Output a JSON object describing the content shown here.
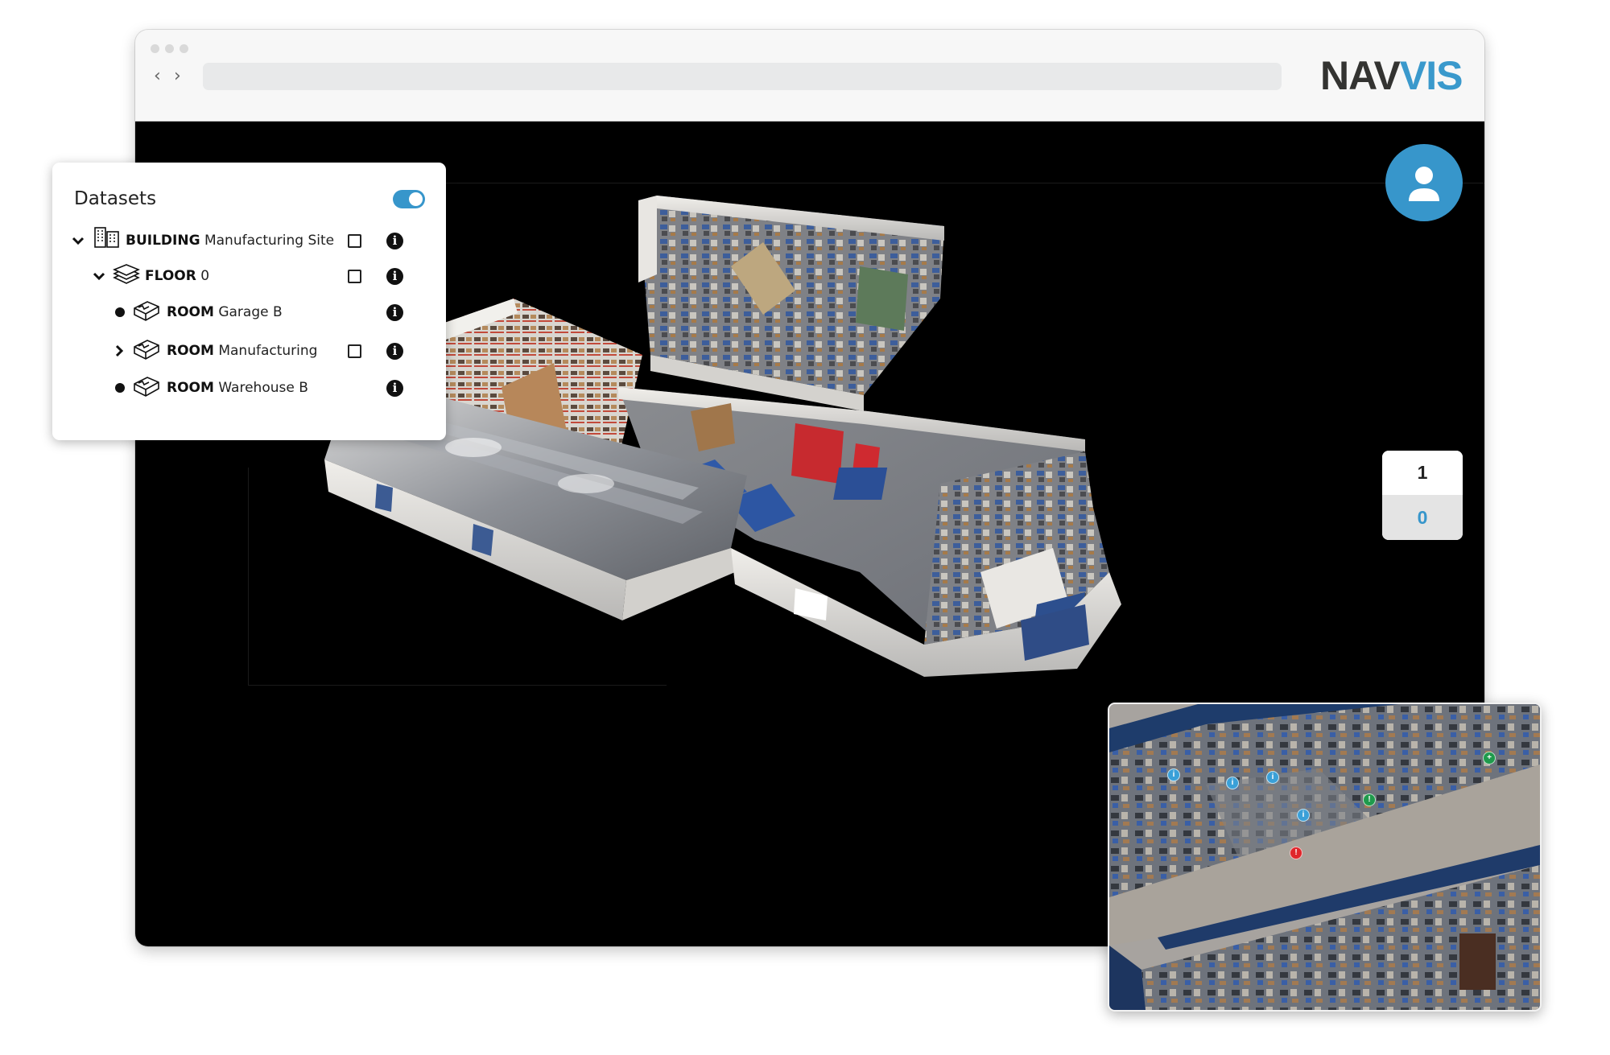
{
  "browser": {
    "url": "",
    "back_icon": "chevron-left-icon",
    "forward_icon": "chevron-right-icon",
    "traffic_lights": [
      "close",
      "minimize",
      "maximize"
    ]
  },
  "brand": {
    "logo_part1": "NAV",
    "logo_part2": "VIS",
    "text_color": "#333331",
    "accent_color": "#3a99cc"
  },
  "user_button": {
    "icon": "user-icon",
    "color": "#3796cb"
  },
  "floor_selector": {
    "floors": [
      {
        "label": "1",
        "active": false
      },
      {
        "label": "0",
        "active": true
      }
    ]
  },
  "datasets_panel": {
    "title": "Datasets",
    "toggle_on": true,
    "items": [
      {
        "level": 0,
        "expander": "chevron-down",
        "icon": "building-icon",
        "type": "BUILDING",
        "name": "Manufacturing Site",
        "checkbox": true,
        "checked": false,
        "info": "i"
      },
      {
        "level": 1,
        "expander": "chevron-down",
        "icon": "layers-icon",
        "type": "FLOOR",
        "name": "0",
        "checkbox": true,
        "checked": false,
        "info": "i"
      },
      {
        "level": 2,
        "expander": "bullet",
        "icon": "room-icon",
        "type": "ROOM",
        "name": "Garage B",
        "checkbox": false,
        "info": "i"
      },
      {
        "level": 2,
        "expander": "chevron-right",
        "icon": "room-icon",
        "type": "ROOM",
        "name": "Manufacturing",
        "checkbox": true,
        "checked": false,
        "info": "i"
      },
      {
        "level": 2,
        "expander": "bullet",
        "icon": "room-icon",
        "type": "ROOM",
        "name": "Warehouse B",
        "checkbox": false,
        "info": "i"
      }
    ]
  },
  "minimap": {
    "description": "top-down point cloud floor plan",
    "markers": [
      {
        "type": "info",
        "color": "#3aa0d8",
        "glyph": "i"
      },
      {
        "type": "info",
        "color": "#3aa0d8",
        "glyph": "i"
      },
      {
        "type": "info",
        "color": "#3aa0d8",
        "glyph": "i"
      },
      {
        "type": "info",
        "color": "#3aa0d8",
        "glyph": "i"
      },
      {
        "type": "alert",
        "color": "#e0262b",
        "glyph": "!"
      },
      {
        "type": "success",
        "color": "#1f9a4c",
        "glyph": "!"
      },
      {
        "type": "success",
        "color": "#1f9a4c",
        "glyph": "+"
      }
    ]
  },
  "viewer": {
    "content": "3D point cloud model of manufacturing building"
  }
}
